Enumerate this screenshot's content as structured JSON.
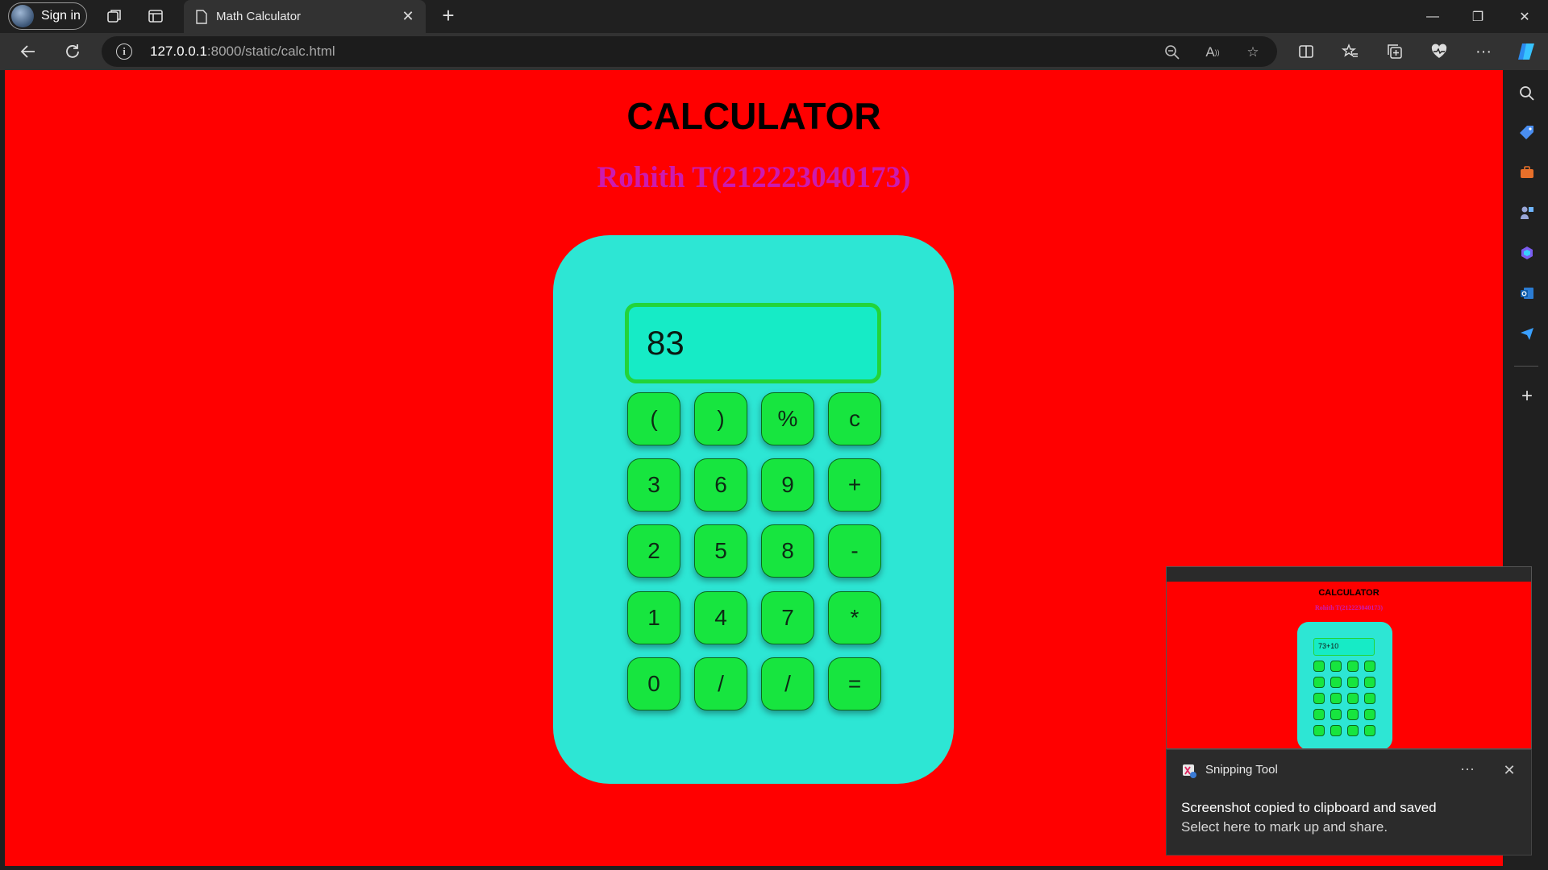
{
  "browser": {
    "sign_in_label": "Sign in",
    "tab_title": "Math Calculator",
    "url_host": "127.0.0.1",
    "url_rest": ":8000/static/calc.html",
    "icons": {
      "workspaces": "workspaces-icon",
      "tab_actions": "tab-actions-icon",
      "page": "page-icon",
      "back": "back-arrow-icon",
      "refresh": "refresh-icon",
      "zoom": "zoom-out-icon",
      "read_aloud": "read-aloud-icon",
      "favorite": "star-icon",
      "split": "split-screen-icon",
      "favorites": "favorites-icon",
      "collections": "collections-icon",
      "health": "browser-essentials-icon",
      "more": "more-icon",
      "copilot": "copilot-icon"
    },
    "sidebar_icons": [
      "search-icon",
      "tag-icon",
      "briefcase-icon",
      "games-icon",
      "m365-icon",
      "outlook-icon",
      "send-icon",
      "add-icon"
    ]
  },
  "page": {
    "title": "CALCULATOR",
    "subtitle": "Rohith T(212223040173)",
    "background_color": "#ff0000",
    "calculator_color": "#2de6d4",
    "key_color": "#17e53f",
    "display_value": "83",
    "keys": [
      [
        "(",
        ")",
        "%",
        "c"
      ],
      [
        "3",
        "6",
        "9",
        "+"
      ],
      [
        "2",
        "5",
        "8",
        "-"
      ],
      [
        "1",
        "4",
        "7",
        "*"
      ],
      [
        "0",
        "/",
        "/",
        "="
      ]
    ]
  },
  "snip": {
    "thumbnail": {
      "title": "CALCULATOR",
      "subtitle": "Rohith T(212223040173)",
      "display_value": "73+10"
    },
    "toast": {
      "app_name": "Snipping Tool",
      "message": "Screenshot copied to clipboard and saved",
      "hint": "Select here to mark up and share."
    }
  }
}
